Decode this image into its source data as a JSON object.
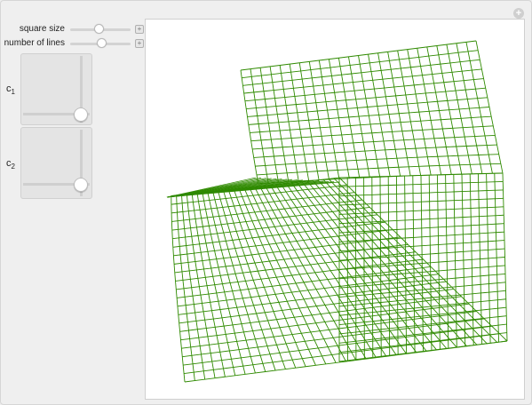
{
  "controls": {
    "square_size": {
      "label": "square size",
      "value": 0.65
    },
    "number_of_lines": {
      "label": "number of lines",
      "value": 0.55
    }
  },
  "pads": {
    "c1": {
      "label": "c",
      "sub": "1",
      "x": 1.0,
      "y": 0.0
    },
    "c2": {
      "label": "c",
      "sub": "2",
      "x": 1.0,
      "y": 0.0
    }
  },
  "buttons": {
    "plus_symbol": "+"
  },
  "colors": {
    "grid_line": "#2f8a00",
    "grid_line_dark": "#1e6b00"
  }
}
